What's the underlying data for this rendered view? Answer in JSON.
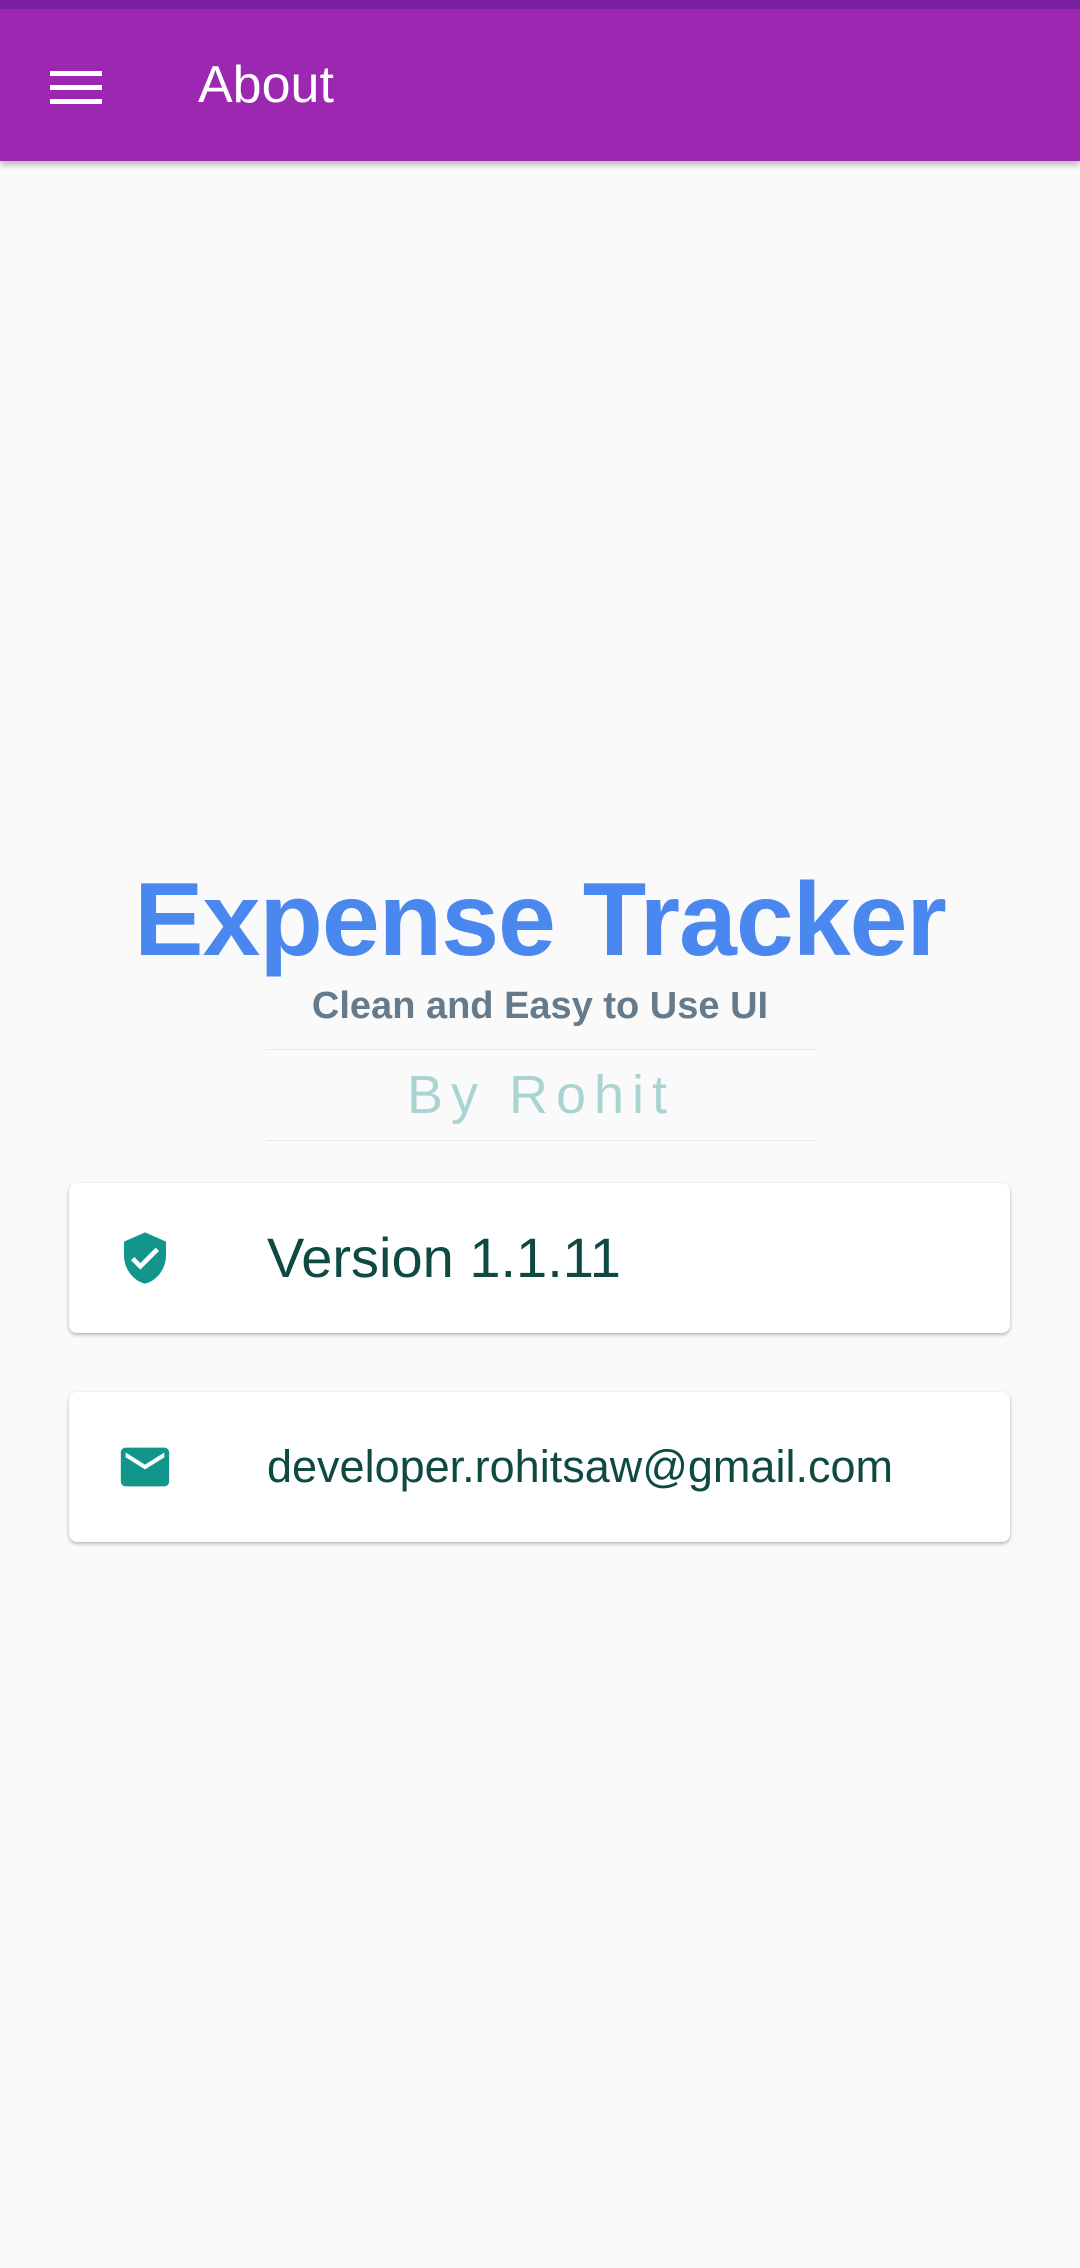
{
  "app_bar": {
    "title": "About",
    "menu_icon": "hamburger-menu-icon",
    "color": "#9c27b0"
  },
  "hero": {
    "app_name": "Expense Tracker",
    "tagline": "Clean and Easy to Use UI",
    "author": "By Rohit"
  },
  "cards": {
    "version": {
      "icon": "verified-shield-icon",
      "text": "Version 1.1.11"
    },
    "email": {
      "icon": "email-icon",
      "text": "developer.rohitsaw@gmail.com"
    }
  },
  "colors": {
    "accent": "#4a87ee",
    "icon": "#12968b",
    "text": "#0e4a42"
  }
}
